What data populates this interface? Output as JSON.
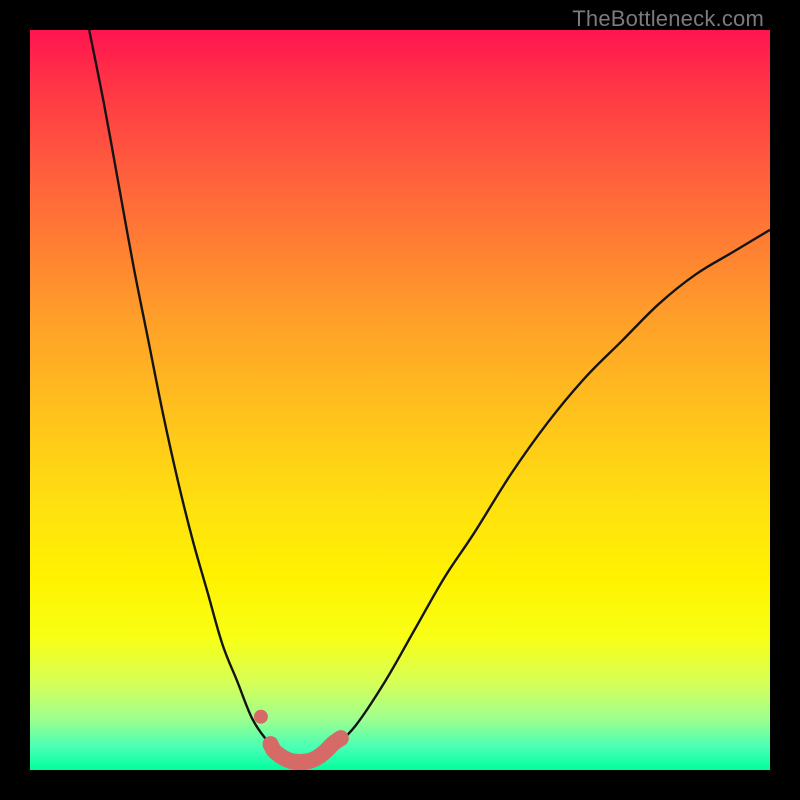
{
  "watermark": "TheBottleneck.com",
  "chart_data": {
    "type": "line",
    "title": "",
    "xlabel": "",
    "ylabel": "",
    "xlim": [
      0,
      100
    ],
    "ylim": [
      0,
      100
    ],
    "grid": false,
    "legend": false,
    "series": [
      {
        "name": "left-curve",
        "kind": "curve",
        "stroke": "#141414",
        "x": [
          8,
          10,
          12,
          14,
          16,
          18,
          20,
          22,
          24,
          26,
          28,
          30,
          32,
          33
        ],
        "y": [
          100,
          90,
          79,
          68,
          58,
          48,
          39,
          31,
          24,
          17,
          12,
          7,
          4,
          3
        ]
      },
      {
        "name": "right-curve",
        "kind": "curve",
        "stroke": "#141414",
        "x": [
          41,
          44,
          48,
          52,
          56,
          60,
          65,
          70,
          75,
          80,
          85,
          90,
          95,
          100
        ],
        "y": [
          3,
          6,
          12,
          19,
          26,
          32,
          40,
          47,
          53,
          58,
          63,
          67,
          70,
          73
        ]
      },
      {
        "name": "highlight-region",
        "kind": "thick",
        "stroke": "#d66a66",
        "x": [
          32.5,
          33,
          34,
          35,
          36,
          37,
          38,
          39,
          40,
          41,
          42
        ],
        "y": [
          3.5,
          2.6,
          1.8,
          1.3,
          1.1,
          1.1,
          1.3,
          1.8,
          2.6,
          3.6,
          4.3
        ]
      },
      {
        "name": "highlight-dot",
        "kind": "dot",
        "fill": "#d66a66",
        "x": [
          31.2
        ],
        "y": [
          7.2
        ]
      }
    ]
  }
}
